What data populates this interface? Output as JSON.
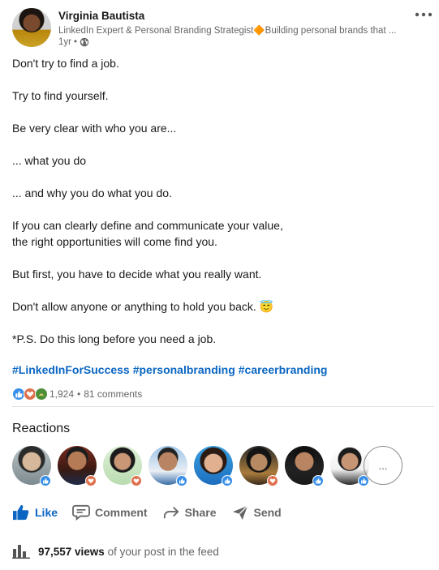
{
  "author": {
    "name": "Virginia Bautista",
    "headline": "LinkedIn Expert & Personal Branding Strategist🔶Building personal brands that ...",
    "age": "1yr",
    "dot": "•"
  },
  "post": {
    "lines": [
      "Don't try to find a job.",
      "Try to find yourself.",
      "Be very clear with who you are...",
      "... what you do",
      "... and why you do what you do.",
      "If you can clearly define and communicate your value,",
      "the right opportunities will come find you.",
      "But first, you have to decide what you really want.",
      "Don't allow anyone or anything to hold you back. 😇",
      "*P.S. Do this long before you need a job."
    ],
    "hashtags": [
      "#LinkedInForSuccess",
      "#personalbranding",
      "#careerbranding"
    ]
  },
  "social": {
    "reaction_count": "1,924",
    "separator": "•",
    "comments": "81 comments"
  },
  "reactions": {
    "title": "Reactions",
    "more_label": "...",
    "people": [
      {
        "type": "like"
      },
      {
        "type": "love"
      },
      {
        "type": "love"
      },
      {
        "type": "like"
      },
      {
        "type": "like"
      },
      {
        "type": "love"
      },
      {
        "type": "like"
      },
      {
        "type": "like"
      }
    ]
  },
  "actions": {
    "like": "Like",
    "comment": "Comment",
    "share": "Share",
    "send": "Send"
  },
  "analytics": {
    "views_count": "97,557 views",
    "views_suffix": "of your post in the feed"
  },
  "colors": {
    "brand_blue": "#0a66c2",
    "love_red": "#c75a3a",
    "support_green": "#3f8a3a",
    "muted": "#666666"
  }
}
